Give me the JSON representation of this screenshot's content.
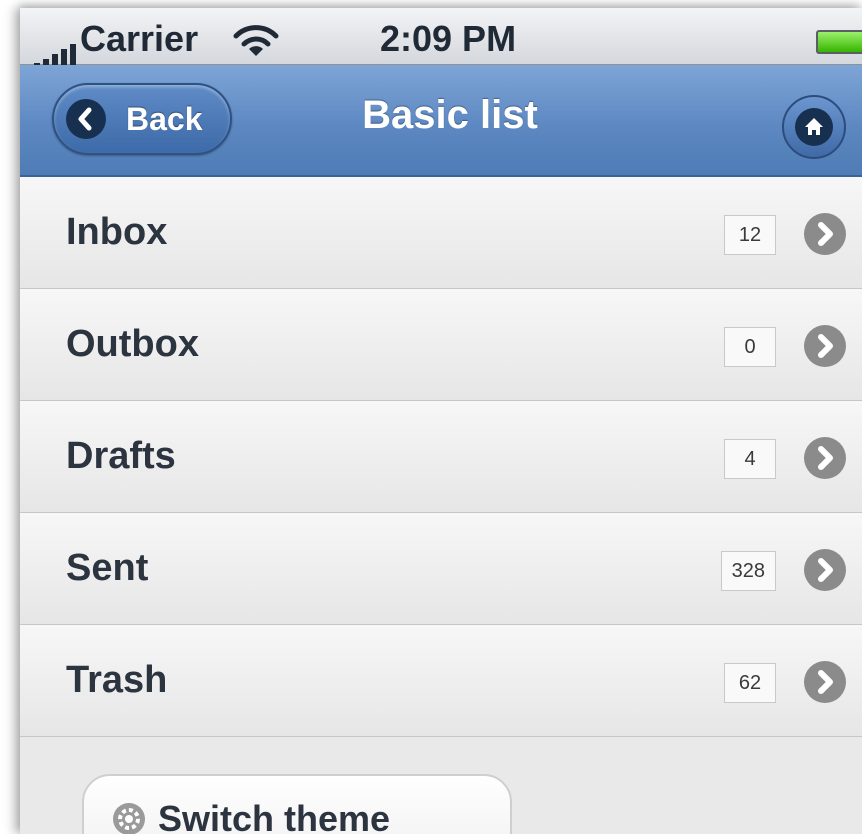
{
  "status_bar": {
    "carrier": "Carrier",
    "time": "2:09 PM"
  },
  "header": {
    "back_label": "Back",
    "title": "Basic list"
  },
  "list": {
    "items": [
      {
        "label": "Inbox",
        "count": "12"
      },
      {
        "label": "Outbox",
        "count": "0"
      },
      {
        "label": "Drafts",
        "count": "4"
      },
      {
        "label": "Sent",
        "count": "328"
      },
      {
        "label": "Trash",
        "count": "62"
      }
    ]
  },
  "footer": {
    "switch_theme_label": "Switch theme"
  },
  "icons": [
    "signal-icon",
    "wifi-icon",
    "battery-icon",
    "back-arrow-icon",
    "home-icon",
    "chevron-right-icon",
    "gear-icon"
  ],
  "colors": {
    "header_blue": "#5d88c2",
    "battery_green": "#36b400",
    "text_dark": "#2c3440"
  }
}
